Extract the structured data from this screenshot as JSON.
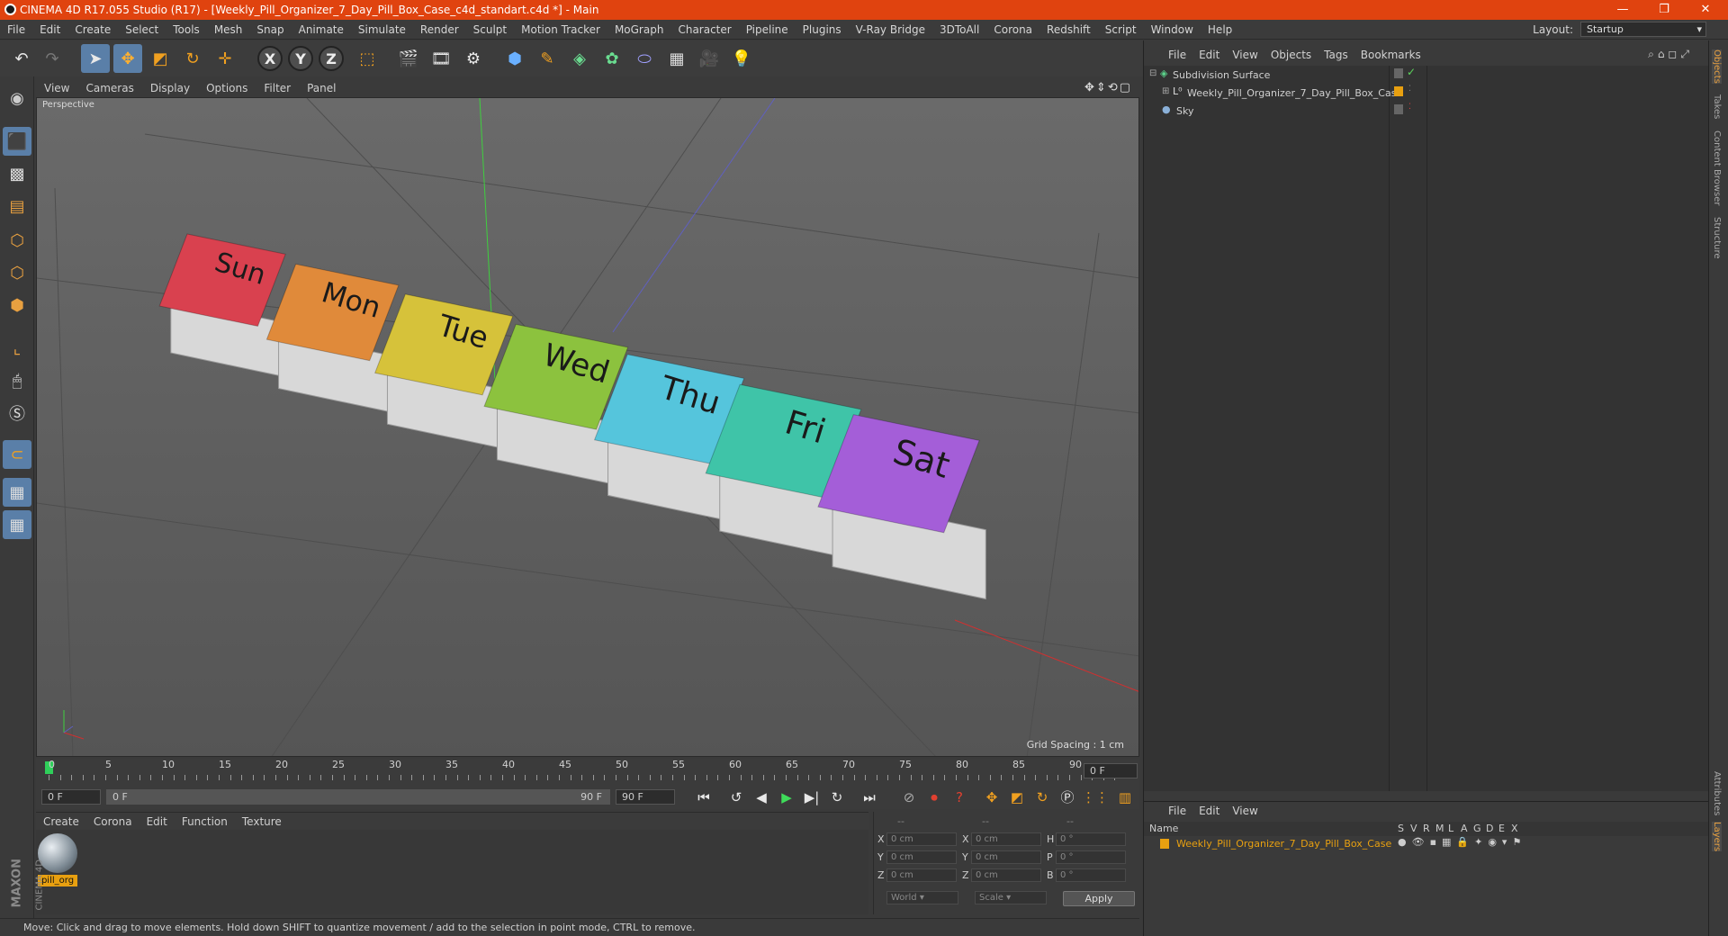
{
  "window": {
    "title": "CINEMA 4D R17.055 Studio (R17) - [Weekly_Pill_Organizer_7_Day_Pill_Box_Case_c4d_standart.c4d *] - Main",
    "minimize": "—",
    "restore": "❐",
    "close": "✕"
  },
  "menubar": [
    "File",
    "Edit",
    "Create",
    "Select",
    "Tools",
    "Mesh",
    "Snap",
    "Animate",
    "Simulate",
    "Render",
    "Sculpt",
    "Motion Tracker",
    "MoGraph",
    "Character",
    "Pipeline",
    "Plugins",
    "V-Ray Bridge",
    "3DToAll",
    "Corona",
    "Redshift",
    "Script",
    "Window",
    "Help"
  ],
  "layout": {
    "label": "Layout:",
    "value": "Startup"
  },
  "viewport": {
    "menu": [
      "View",
      "Cameras",
      "Display",
      "Options",
      "Filter",
      "Panel"
    ],
    "label": "Perspective",
    "grid_spacing": "Grid Spacing : 1 cm",
    "days": [
      "Sun",
      "Mon",
      "Tue",
      "Wed",
      "Thu",
      "Fri",
      "Sat"
    ],
    "day_colors": [
      "#d9414f",
      "#e08a3a",
      "#d6c23a",
      "#8cc23e",
      "#55c5dc",
      "#3fc4a8",
      "#a45ed8"
    ]
  },
  "timeline": {
    "ticks": [
      "0",
      "5",
      "10",
      "15",
      "20",
      "25",
      "30",
      "35",
      "40",
      "45",
      "50",
      "55",
      "60",
      "65",
      "70",
      "75",
      "80",
      "85",
      "90"
    ],
    "frame_end": "0 F"
  },
  "transport": {
    "start": "0 F",
    "range_start": "0 F",
    "range_end": "90 F",
    "end": "90 F"
  },
  "material": {
    "menu": [
      "Create",
      "Corona",
      "Edit",
      "Function",
      "Texture"
    ],
    "items": [
      {
        "name": "pill_org"
      }
    ]
  },
  "coords": {
    "headers": [
      "--",
      "--",
      "--"
    ],
    "rows": [
      {
        "a": "X",
        "av": "0 cm",
        "b": "X",
        "bv": "0 cm",
        "c": "H",
        "cv": "0 °"
      },
      {
        "a": "Y",
        "av": "0 cm",
        "b": "Y",
        "bv": "0 cm",
        "c": "P",
        "cv": "0 °"
      },
      {
        "a": "Z",
        "av": "0 cm",
        "b": "Z",
        "bv": "0 cm",
        "c": "B",
        "cv": "0 °"
      }
    ],
    "world": "World",
    "scale": "Scale",
    "apply": "Apply"
  },
  "status": "Move: Click and drag to move elements. Hold down SHIFT to quantize movement / add to the selection in point mode, CTRL to remove.",
  "brand": {
    "maxon": "MAXON",
    "c4d": "CINEMA 4D"
  },
  "objects": {
    "menu": [
      "File",
      "Edit",
      "View",
      "Objects",
      "Tags",
      "Bookmarks"
    ],
    "items": [
      {
        "name": "Subdivision Surface",
        "color": "#d0d0d0"
      },
      {
        "name": "Weekly_Pill_Organizer_7_Day_Pill_Box_Case",
        "color": "#d0d0d0"
      },
      {
        "name": "Sky",
        "color": "#d0d0d0"
      }
    ]
  },
  "layers": {
    "menu": [
      "File",
      "Edit",
      "View"
    ],
    "header": {
      "name": "Name",
      "cols": [
        "S",
        "V",
        "R",
        "M",
        "L",
        "A",
        "G",
        "D",
        "E",
        "X"
      ]
    },
    "row": {
      "name": "Weekly_Pill_Organizer_7_Day_Pill_Box_Case",
      "color": "#e8a010"
    }
  },
  "sidetabs": [
    "Objects",
    "Takes",
    "Content Browser",
    "Structure"
  ],
  "sidetabs_bottom": [
    "Attributes",
    "Layers"
  ]
}
